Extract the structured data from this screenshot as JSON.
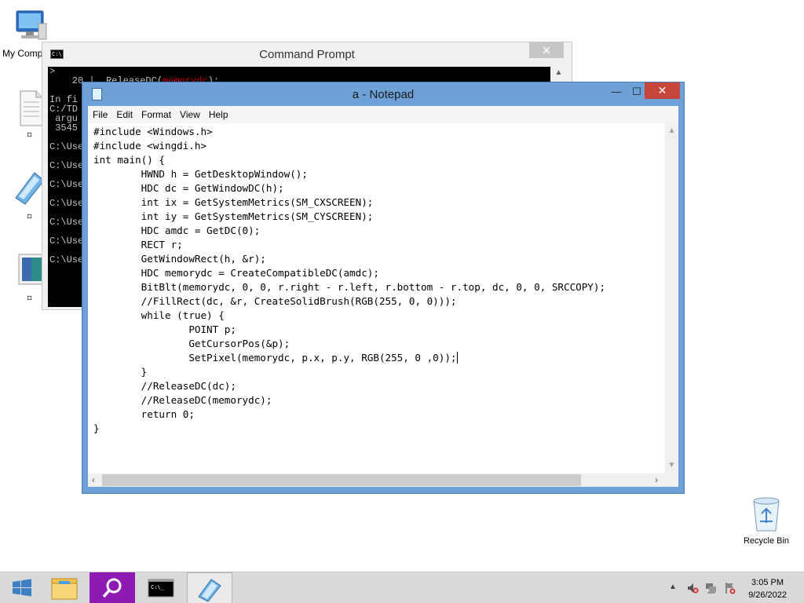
{
  "desktop": {
    "icons": [
      {
        "label": "My Computer"
      },
      {
        "label": ""
      },
      {
        "label": ""
      },
      {
        "label": ""
      }
    ],
    "recycle_bin": {
      "label": "Recycle Bin"
    }
  },
  "cmd": {
    "title": "Command Prompt",
    "close_glyph": "✕",
    "lines": [
      {
        "text": ">"
      },
      {
        "text": "    20 |  ReleaseDC(",
        "red": "memorydc",
        "after": ");"
      },
      {
        "text": "      |"
      },
      {
        "text": "In fi"
      },
      {
        "text": "C:/TD"
      },
      {
        "text": " argu"
      },
      {
        "text": " 3545"
      },
      {
        "text": ""
      },
      {
        "text": "C:\\Use"
      },
      {
        "text": ""
      },
      {
        "text": "C:\\Use"
      },
      {
        "text": ""
      },
      {
        "text": "C:\\Use"
      },
      {
        "text": ""
      },
      {
        "text": "C:\\Use"
      },
      {
        "text": ""
      },
      {
        "text": "C:\\Use"
      },
      {
        "text": ""
      },
      {
        "text": "C:\\Use"
      },
      {
        "text": ""
      },
      {
        "text": "C:\\Use"
      }
    ]
  },
  "notepad": {
    "title": "a - Notepad",
    "min_glyph": "—",
    "max_glyph": "☐",
    "close_glyph": "✕",
    "menu": [
      "File",
      "Edit",
      "Format",
      "View",
      "Help"
    ],
    "code_lines": [
      "#include <Windows.h>",
      "#include <wingdi.h>",
      "int main() {",
      "        HWND h = GetDesktopWindow();",
      "        HDC dc = GetWindowDC(h);",
      "        int ix = GetSystemMetrics(SM_CXSCREEN);",
      "        int iy = GetSystemMetrics(SM_CYSCREEN);",
      "        HDC amdc = GetDC(0);",
      "        RECT r;",
      "        GetWindowRect(h, &r);",
      "        HDC memorydc = CreateCompatibleDC(amdc);",
      "        BitBlt(memorydc, 0, 0, r.right - r.left, r.bottom - r.top, dc, 0, 0, SRCCOPY);",
      "        //FillRect(dc, &r, CreateSolidBrush(RGB(255, 0, 0)));",
      "        while (true) {",
      "                POINT p;",
      "                GetCursorPos(&p);",
      "                SetPixel(memorydc, p.x, p.y, RGB(255, 0 ,0));",
      "        }",
      "        //ReleaseDC(dc);",
      "        //ReleaseDC(memorydc);",
      "        return 0;",
      "}"
    ],
    "caret_line": 16
  },
  "taskbar": {
    "items": [
      "start",
      "file-explorer",
      "search-app",
      "command-prompt",
      "notepad"
    ],
    "clock_time": "3:05 PM",
    "clock_date": "9/26/2022"
  },
  "colors": {
    "notepad_frame": "#6ea1d6",
    "close_red": "#c7463b",
    "search_purple": "#8e1ab3",
    "start_blue": "#3c7fc2"
  }
}
